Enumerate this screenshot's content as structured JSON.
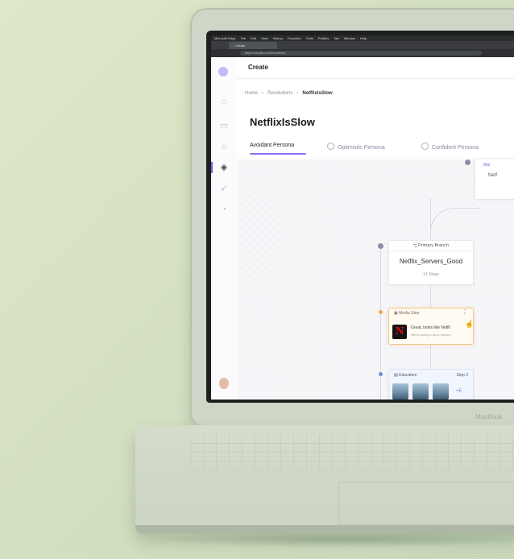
{
  "scene": {
    "background_color": "#d8e3c5",
    "device": "laptop",
    "brand_mark": "MacBook"
  },
  "browser": {
    "menubar_items": [
      "Microsoft Edge",
      "File",
      "Edit",
      "View",
      "History",
      "Favorites",
      "Tools",
      "Profiles",
      "Tab",
      "Window",
      "Help"
    ],
    "tab_label": "Create",
    "url": "https://create.net/resolutions"
  },
  "app": {
    "accent_color": "#8e6ff2",
    "topbar_title": "Create",
    "breadcrumb": [
      "Home",
      "Resolutions",
      "NetflixIsSlow"
    ],
    "page_title": "NetflixIsSlow",
    "tabs": [
      {
        "label": "Avoidant Persona",
        "active": true
      },
      {
        "label": "Optimistic Persona",
        "active": false
      },
      {
        "label": "Confident Persona",
        "active": false
      }
    ],
    "sidebar_icons": [
      "home-icon",
      "chat-icon",
      "lightbulb-icon",
      "shapes-icon",
      "rocket-icon",
      "bell-icon"
    ]
  },
  "flow": {
    "main_card": {
      "label": "Mai",
      "text": "Netf"
    },
    "branch_card": {
      "header": "Primary Branch",
      "name": "Netflix_Servers_Good",
      "steps": "14 Steps"
    },
    "media_card": {
      "header": "Media Step",
      "text": "Great, looks like Netfli",
      "sub": "We're going to us a number..."
    },
    "education_card": {
      "header": "Education",
      "step": "Step 2",
      "more": "+5"
    }
  }
}
